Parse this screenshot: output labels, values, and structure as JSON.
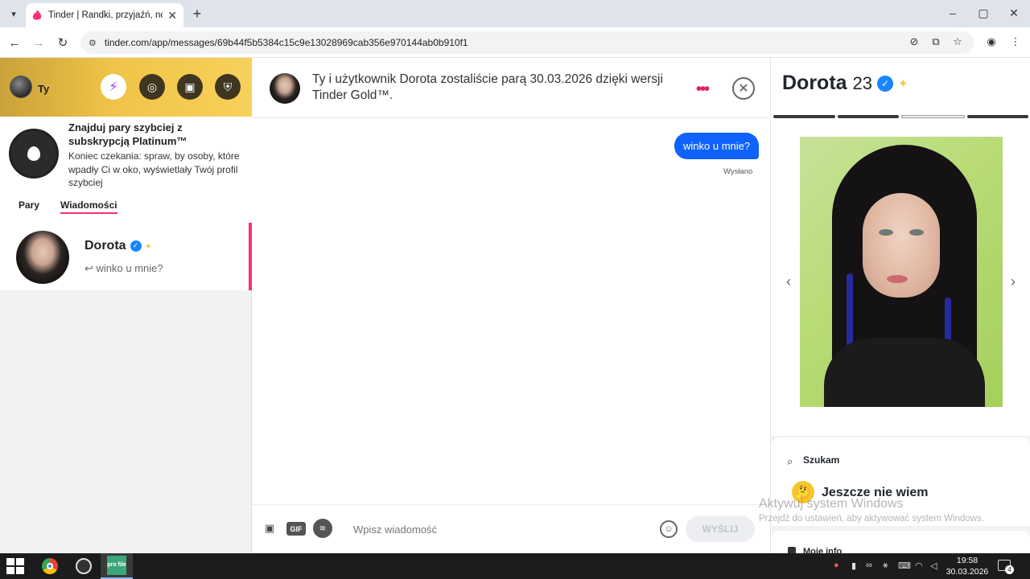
{
  "browser": {
    "tab_title": "Tinder | Randki, przyjaźń, nowe",
    "url": "tinder.com/app/messages/69b44f5b5384c15c9e13028969cab356e970144ab0b910f1"
  },
  "sidebar": {
    "me_name": "Ty",
    "promo": {
      "title": "Znajduj pary szybciej z subskrypcją Platinum™",
      "text": "Koniec czekania: spraw, by osoby, które wpadły Ci w oko, wyświetlały Twój profil szybciej"
    },
    "tabs": [
      {
        "label": "Pary",
        "active": false
      },
      {
        "label": "Wiadomości",
        "active": true
      }
    ],
    "conversations": [
      {
        "name": "Dorota",
        "last_message": "↩ winko u mnie?",
        "verified": true
      }
    ]
  },
  "chat": {
    "match_text": "Ty i użytkownik Dorota zostaliście parą 30.03.2026 dzięki wersji Tinder Gold™.",
    "messages": [
      {
        "text": "winko u mnie?",
        "from_me": true,
        "status": "Wysłano"
      }
    ],
    "composer": {
      "gif_label": "GIF",
      "placeholder": "Wpisz wiadomość",
      "send_label": "WYŚLIJ"
    }
  },
  "profile": {
    "name": "Dorota",
    "age": "23",
    "verified": true,
    "photo_count": 4,
    "active_photo_index": 2,
    "looking_label": "Szukam",
    "looking_value": "Jeszcze nie wiem",
    "next_section_label": "Moje info"
  },
  "watermark": {
    "title": "Aktywuj system Windows",
    "subtitle": "Przejdź do ustawień, aby aktywować system Windows."
  },
  "taskbar": {
    "time": "19:58",
    "date": "30.03.2026",
    "notification_count": "4",
    "profile_app_label": "pro file"
  },
  "colors": {
    "accent_pink": "#fd2f6f",
    "bubble_blue": "#0f62fe",
    "gold": "#f0c448",
    "verified_blue": "#1786ff"
  }
}
